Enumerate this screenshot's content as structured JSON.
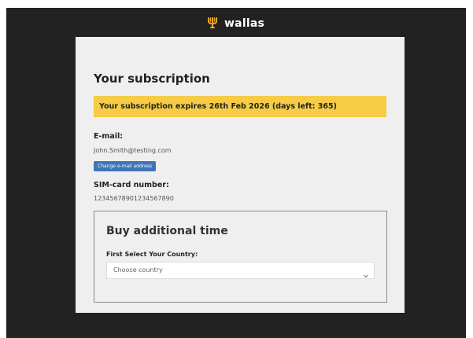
{
  "header": {
    "brand_name": "wallas",
    "brand_icon": "trident-logo-icon",
    "brand_color": "#f5a623"
  },
  "subscription": {
    "title": "Your subscription",
    "banner_text": "Your subscription expires 26th Feb 2026 (days left: 365)",
    "banner_color": "#f6cb45"
  },
  "email": {
    "label": "E-mail:",
    "value": "John.Smith@testing.com",
    "change_button_label": "Change e-mail address",
    "button_color": "#3f74b8"
  },
  "sim": {
    "label": "SIM-card number:",
    "value": "12345678901234567890"
  },
  "buy": {
    "title": "Buy additional time",
    "country_label": "First Select Your Country:",
    "country_select": {
      "selected": "Choose country",
      "icon": "chevron-down-icon"
    }
  }
}
